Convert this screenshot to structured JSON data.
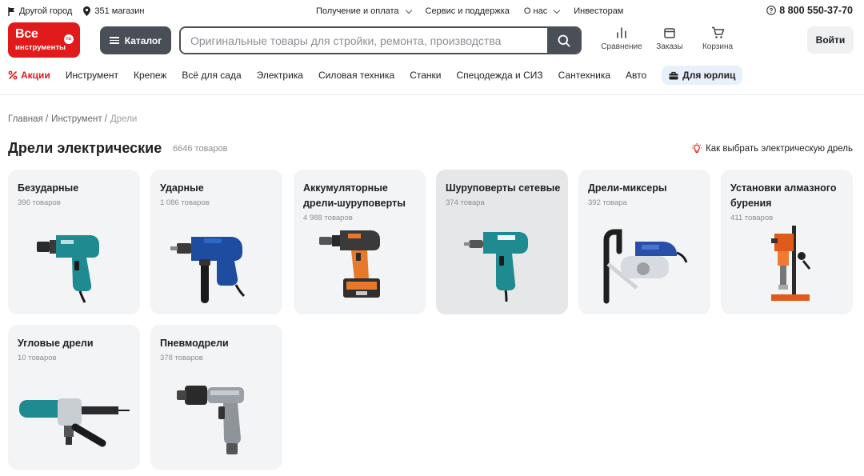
{
  "topbar": {
    "city": "Другой город",
    "stores": "351 магазин",
    "links": [
      "Получение и оплата",
      "Сервис и поддержка",
      "О нас",
      "Инвесторам"
    ],
    "phone": "8 800 550-37-70"
  },
  "header": {
    "logo_line1": "Все",
    "logo_line2": "инструменты",
    "logo_badge": "ru",
    "catalog": "Каталог",
    "search_placeholder": "Оригинальные товары для стройки, ремонта, производства",
    "compare": "Сравнение",
    "orders": "Заказы",
    "cart": "Корзина",
    "login": "Войти"
  },
  "catnav": {
    "sale": "Акции",
    "items": [
      "Инструмент",
      "Крепеж",
      "Всё для сада",
      "Электрика",
      "Силовая техника",
      "Станки",
      "Спецодежда и СИЗ",
      "Сантехника",
      "Авто"
    ],
    "business": "Для юрлиц"
  },
  "breadcrumb": [
    "Главная /",
    "Инструмент /",
    "Дрели"
  ],
  "page": {
    "title": "Дрели электрические",
    "count": "6646 товаров",
    "howto": "Как выбрать электрическую дрель"
  },
  "categories": [
    {
      "name": "Безударные",
      "count": "396 товаров",
      "icon": "drill-teal"
    },
    {
      "name": "Ударные",
      "count": "1 086 товаров",
      "icon": "drill-blue"
    },
    {
      "name": "Аккумуляторные дрели-шуруповерты",
      "count": "4 988 товаров",
      "icon": "cordless-drill-orange"
    },
    {
      "name": "Шуруповерты сетевые",
      "count": "374 товара",
      "icon": "impact-driver-teal"
    },
    {
      "name": "Дрели-миксеры",
      "count": "392 товара",
      "icon": "drill-mixer"
    },
    {
      "name": "Установки алмазного бурения",
      "count": "411 товаров",
      "icon": "core-drill-rig"
    },
    {
      "name": "Угловые дрели",
      "count": "10 товаров",
      "icon": "angle-drill"
    },
    {
      "name": "Пневмодрели",
      "count": "378 товаров",
      "icon": "pneumatic-drill"
    }
  ],
  "colors": {
    "brand": "#e11b1b",
    "dark": "#4a4f57",
    "card": "#f3f4f6"
  }
}
